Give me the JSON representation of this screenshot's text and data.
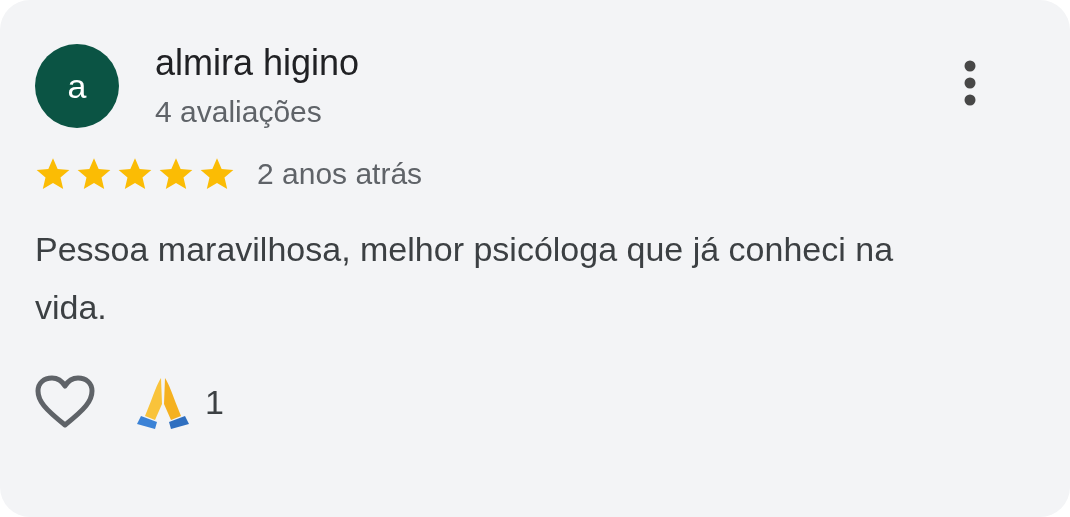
{
  "review": {
    "avatar_letter": "a",
    "author": "almira higino",
    "review_count": "4 avaliações",
    "stars": 5,
    "time": "2 anos atrás",
    "text": "Pessoa maravilhosa, melhor psicóloga que já conheci na vida.",
    "reaction_count": "1"
  }
}
